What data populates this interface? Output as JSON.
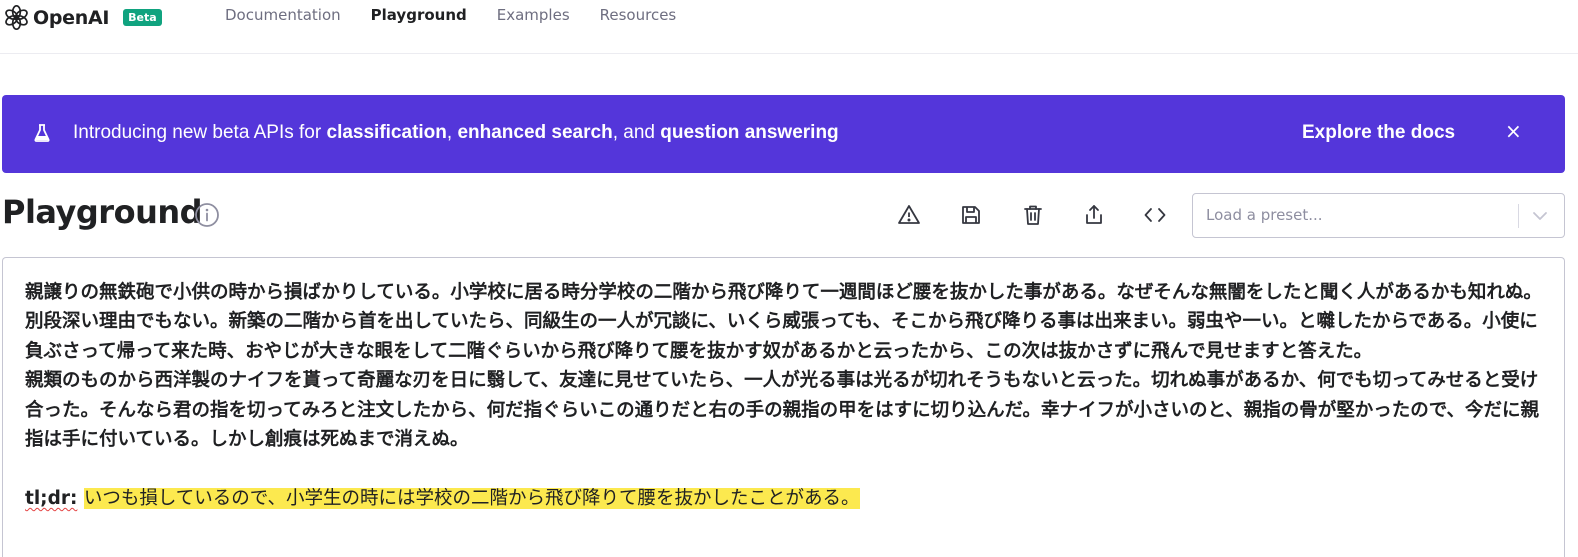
{
  "nav": {
    "brand": "OpenAI",
    "badge": "Beta",
    "links": [
      "Documentation",
      "Playground",
      "Examples",
      "Resources"
    ],
    "active": "Playground"
  },
  "banner": {
    "text_prefix": "Introducing new beta APIs for ",
    "bold1": "classification",
    "sep1": ", ",
    "bold2": "enhanced search",
    "sep2": ", and ",
    "bold3": "question answering",
    "link": "Explore the docs",
    "close": "×",
    "icon": "flask-icon",
    "color": "#5436da"
  },
  "header": {
    "title": "Playground",
    "info_icon": "info-icon",
    "tools": [
      "warning-icon",
      "save-icon",
      "trash-icon",
      "share-icon",
      "code-icon"
    ],
    "preset_placeholder": "Load a preset..."
  },
  "editor": {
    "paragraph1": "親譲りの無鉄砲で小供の時から損ばかりしている。小学校に居る時分学校の二階から飛び降りて一週間ほど腰を抜かした事がある。なぜそんな無闇をしたと聞く人があるかも知れぬ。別段深い理由でもない。新築の二階から首を出していたら、同級生の一人が冗談に、いくら威張っても、そこから飛び降りる事は出来まい。弱虫や一い。と囃したからである。小使に負ぶさって帰って来た時、おやじが大きな眼をして二階ぐらいから飛び降りて腰を抜かす奴があるかと云ったから、この次は抜かさずに飛んで見せますと答えた。",
    "paragraph2": "親類のものから西洋製のナイフを貰って奇麗な刃を日に翳して、友達に見せていたら、一人が光る事は光るが切れそうもないと云った。切れぬ事があるか、何でも切ってみせると受け合った。そんなら君の指を切ってみろと注文したから、何だ指ぐらいこの通りだと右の手の親指の甲をはすに切り込んだ。幸ナイフが小さいのと、親指の骨が堅かったので、今だに親指は手に付いている。しかし創痕は死ぬまで消えぬ。",
    "tldr_label": "tl;dr:",
    "completion": "いつも損しているので、小学生の時には学校の二階から飛び降りて腰を抜かしたことがある。",
    "highlight_color": "#fce94f"
  }
}
